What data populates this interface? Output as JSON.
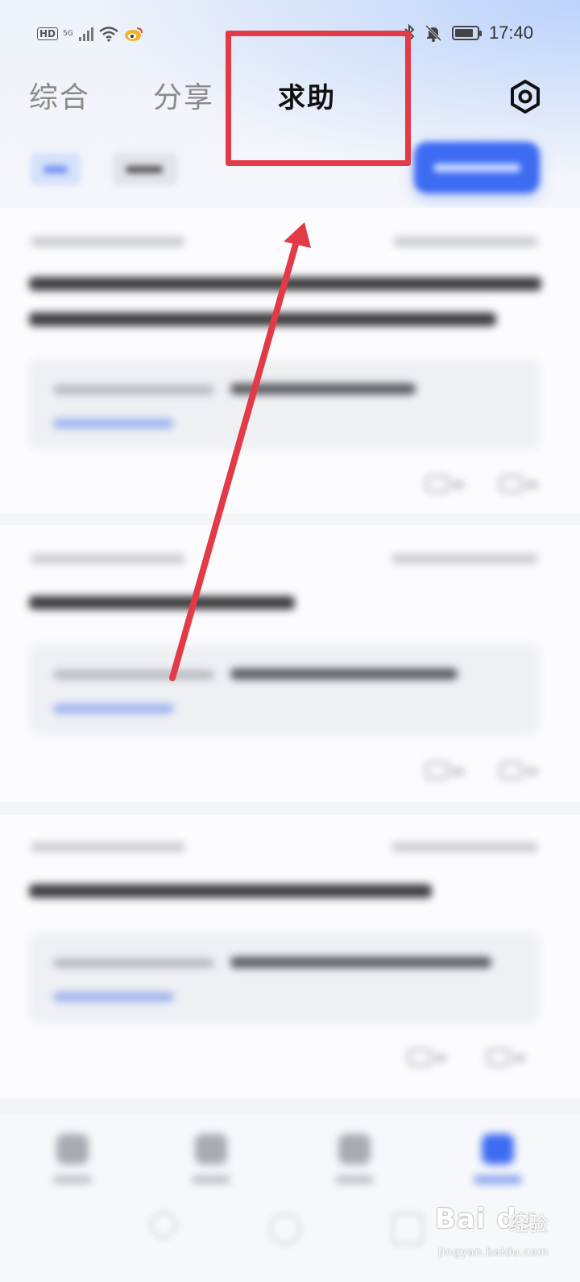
{
  "status_bar": {
    "hd": "HD",
    "network": "5G",
    "time": "17:40"
  },
  "tabs": [
    {
      "label": "综合",
      "active": false
    },
    {
      "label": "分享",
      "active": false
    },
    {
      "label": "求助",
      "active": true
    }
  ],
  "icons": {
    "settings": "gear-icon",
    "bluetooth": "bluetooth-icon",
    "mute": "bell-off-icon",
    "battery": "battery-icon",
    "wifi": "wifi-icon",
    "weibo": "weibo-icon"
  },
  "colors": {
    "accent": "#3d6cf2",
    "annotation": "#e23a47",
    "inactive_tab": "#8a8a8a",
    "active_tab": "#111111"
  },
  "watermark": {
    "logo": "Bai du",
    "cn": "经验",
    "url": "jingyan.baidu.com"
  }
}
